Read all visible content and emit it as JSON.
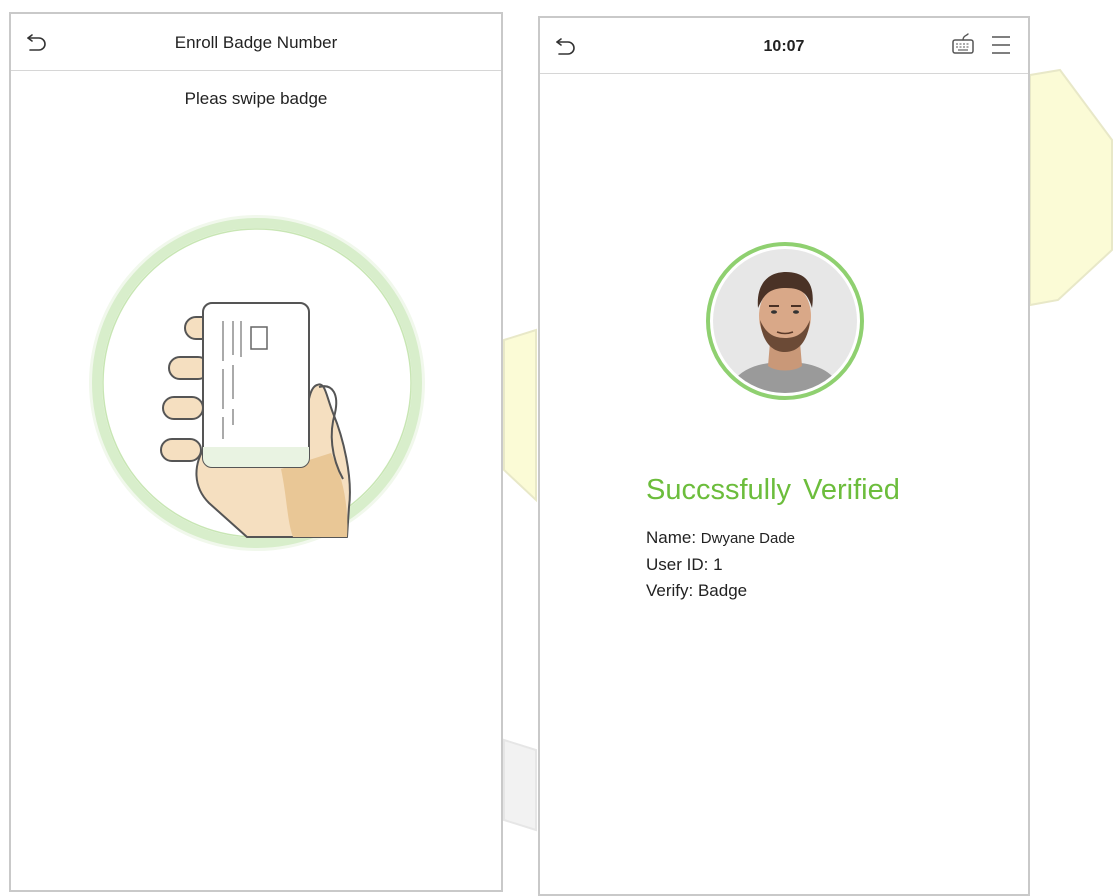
{
  "left_screen": {
    "title": "Enroll Badge Number",
    "instruction": "Pleas swipe badge",
    "icons": {
      "back": "back-arrow-icon",
      "illustration": "hand-holding-card-icon"
    }
  },
  "right_screen": {
    "time": "10:07",
    "icons": {
      "back": "back-arrow-icon",
      "keyboard": "keyboard-icon",
      "menu": "hamburger-menu-icon",
      "avatar": "user-face-photo"
    },
    "status": "Succssfully  Verified",
    "name_label": "Name: ",
    "name_value": "Dwyane Dade",
    "userid_label": "User ID: ",
    "userid_value": "1",
    "verify_label": "Verify: ",
    "verify_value": "Badge"
  },
  "colors": {
    "accent_green": "#6cbd3c",
    "ring_green": "#cfe9c0",
    "border_gray": "#c9c9c9",
    "decor_yellow": "#fbfbd6"
  }
}
